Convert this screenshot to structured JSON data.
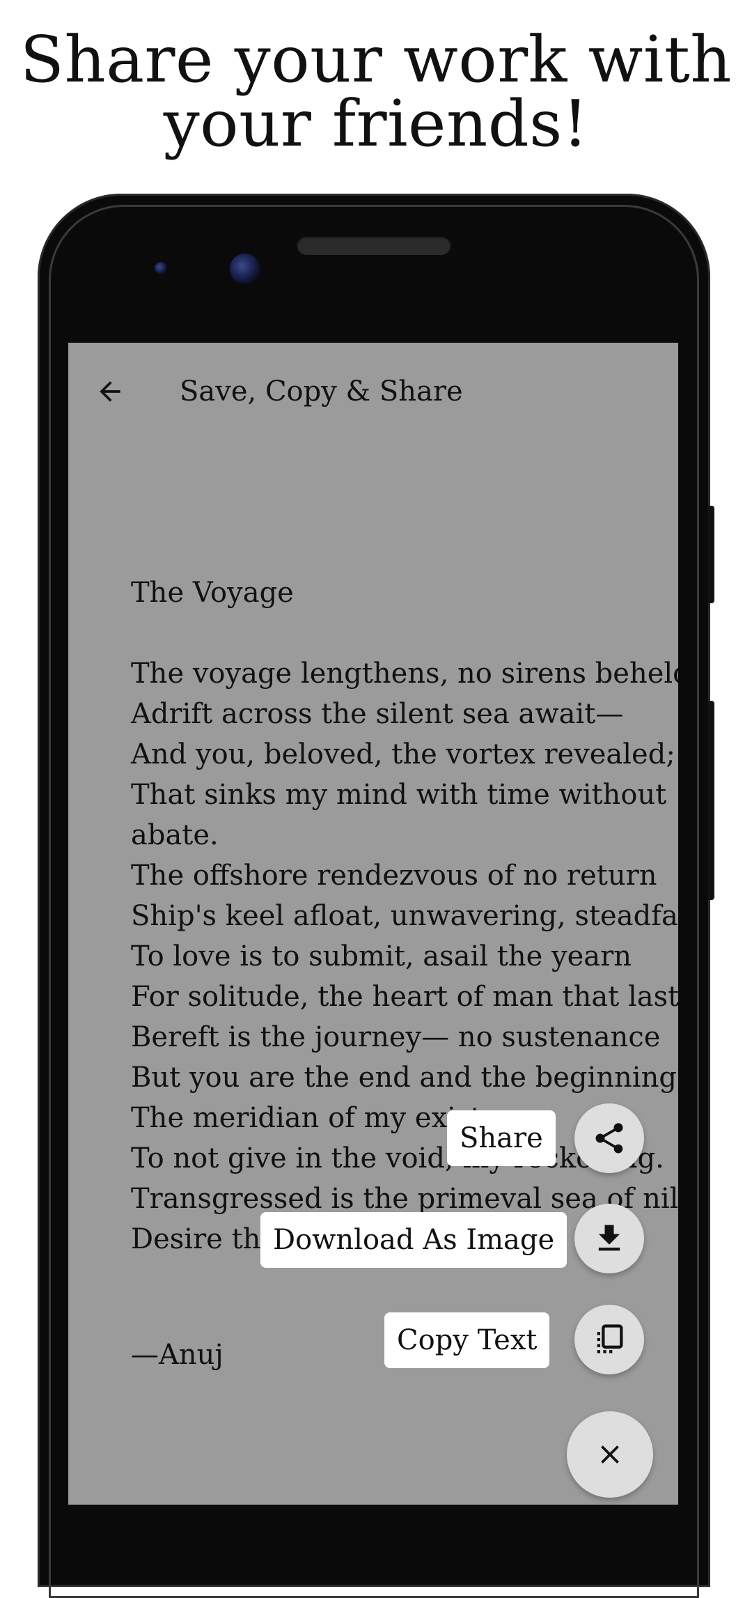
{
  "headline": {
    "line1": "Share your work with",
    "line2": "your friends!"
  },
  "app_bar": {
    "back_icon": "arrow-left-icon",
    "title": "Save, Copy & Share"
  },
  "poem": {
    "title": "The Voyage",
    "lines": [
      "The voyage lengthens, no sirens beheld",
      "Adrift across the silent sea await—",
      "And you, beloved, the vortex revealed;",
      "That sinks my mind with time without",
      "abate.",
      "The offshore rendezvous of no return",
      "Ship's keel afloat, unwavering, steadfast,",
      "To love is to submit, asail the yearn",
      "For solitude, the heart of man that lasts.",
      "Bereft is the journey— no sustenance",
      "But you are the end and the beginning,",
      "The meridian of my existen",
      "To not give in the void, my reckoning.",
      "Transgressed is the primeval sea of nil;",
      "Desire that"
    ],
    "author": "—Anuj"
  },
  "actions": {
    "share_label": "Share",
    "share_icon": "share-icon",
    "download_label": "Download As Image",
    "download_icon": "download-icon",
    "copy_label": "Copy Text",
    "copy_icon": "copy-icon",
    "close_icon": "close-icon"
  },
  "colors": {
    "screen_background": "#9b9b9b",
    "fab_background": "#dedede",
    "label_background": "#ffffff",
    "device_frame": "#0a0a0a"
  }
}
